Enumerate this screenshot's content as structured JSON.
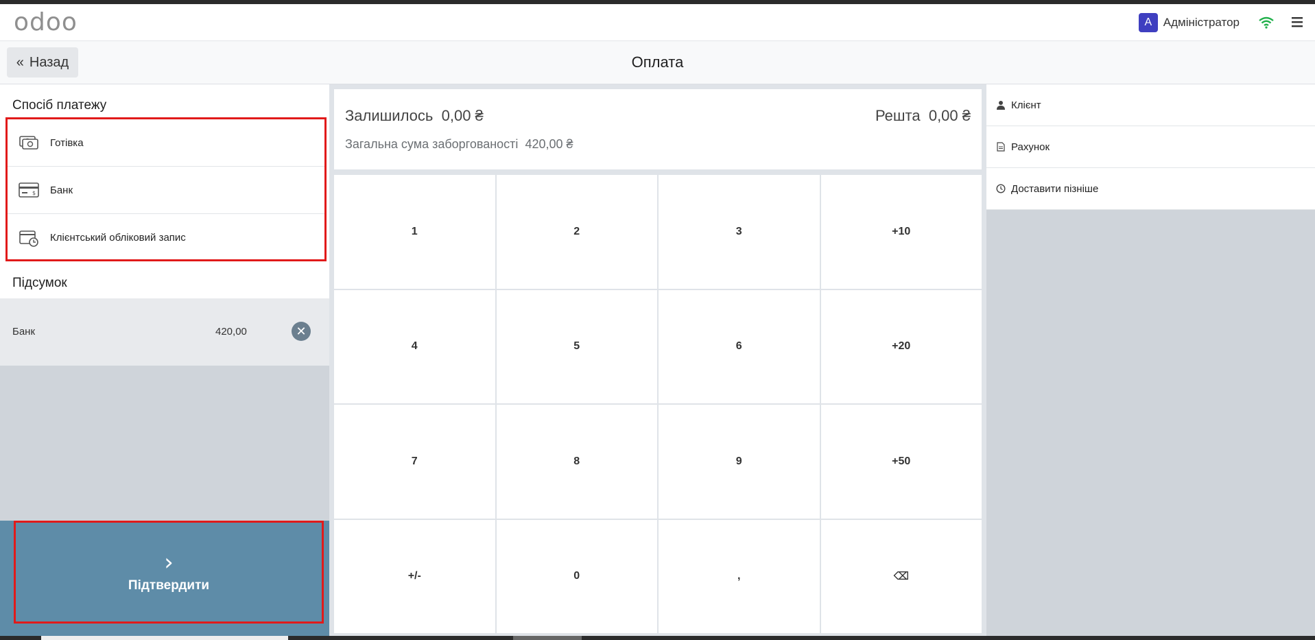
{
  "header": {
    "logo_text": "odoo",
    "user_initial": "A",
    "user_name": "Адміністратор"
  },
  "subheader": {
    "back_label": "Назад",
    "title": "Оплата"
  },
  "payment_methods": {
    "title": "Спосіб платежу",
    "items": [
      {
        "label": "Готівка",
        "icon": "cash-icon"
      },
      {
        "label": "Банк",
        "icon": "bank-card-icon"
      },
      {
        "label": "Клієнтський обліковий запис",
        "icon": "customer-account-icon"
      }
    ]
  },
  "summary": {
    "title": "Підсумок",
    "lines": [
      {
        "label": "Банк",
        "value": "420,00"
      }
    ]
  },
  "confirm": {
    "label": "Підтвердити"
  },
  "status": {
    "remaining_label": "Залишилось",
    "remaining_value": "0,00 ₴",
    "change_label": "Решта",
    "change_value": "0,00 ₴",
    "total_due_label": "Загальна сума заборгованості",
    "total_due_value": "420,00 ₴"
  },
  "numpad": {
    "keys": [
      "1",
      "2",
      "3",
      "+10",
      "4",
      "5",
      "6",
      "+20",
      "7",
      "8",
      "9",
      "+50",
      "+/-",
      "0",
      ",",
      "⌫"
    ]
  },
  "right_panel": {
    "customer_label": "Клієнт",
    "invoice_label": "Рахунок",
    "ship_later_label": "Доставити пізніше"
  },
  "colors": {
    "confirm_bg": "#5e8ca8",
    "highlight_border": "#e11a1a",
    "avatar_bg": "#3f3fc0",
    "wifi": "#21b04b",
    "logo_accent": "#714b67"
  }
}
